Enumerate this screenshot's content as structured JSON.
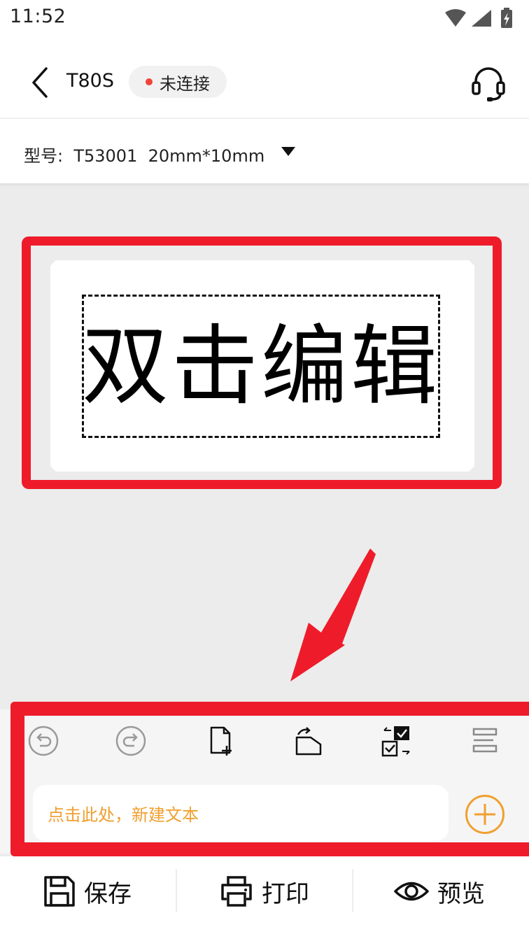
{
  "status_bar": {
    "time": "11:52"
  },
  "header": {
    "back_icon": "chevron-left-icon",
    "device_name": "T80S",
    "connection_status": "未连接",
    "status_color": "#f0433a",
    "support_icon": "headset-icon"
  },
  "model_selector": {
    "text": "型号:  T53001  20mm*10mm"
  },
  "canvas": {
    "text_element": "双击编辑"
  },
  "toolbar": {
    "icons": [
      "undo-icon",
      "redo-icon",
      "new-page-icon",
      "rotate-icon",
      "multi-select-icon",
      "align-icon"
    ]
  },
  "new_text_input": {
    "placeholder": "点击此处，新建文本"
  },
  "actions": {
    "save_label": "保存",
    "print_label": "打印",
    "preview_label": "预览"
  },
  "colors": {
    "annotation_red": "#ee1c2a",
    "accent_orange": "#f0a030",
    "background": "#ececec"
  }
}
